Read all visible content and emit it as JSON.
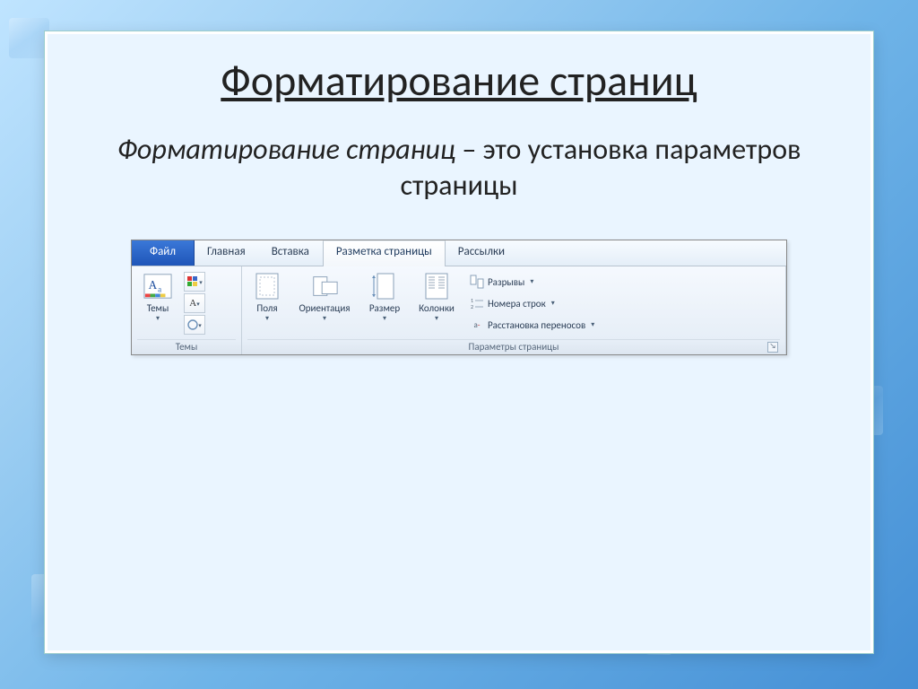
{
  "slide": {
    "title": "Форматирование страниц",
    "definition_term": "Форматирование страниц",
    "definition_rest": " – это установка параметров страницы"
  },
  "ribbon": {
    "tabs": {
      "file": "Файл",
      "home": "Главная",
      "insert": "Вставка",
      "page_layout": "Разметка страницы",
      "mailings": "Рассылки"
    },
    "groups": {
      "themes": {
        "label": "Темы",
        "btn_themes": "Темы"
      },
      "page_setup": {
        "label": "Параметры страницы",
        "btn_margins": "Поля",
        "btn_orientation": "Ориентация",
        "btn_size": "Размер",
        "btn_columns": "Колонки",
        "row_breaks": "Разрывы",
        "row_line_numbers": "Номера строк",
        "row_hyphenation": "Расстановка переносов"
      }
    }
  }
}
